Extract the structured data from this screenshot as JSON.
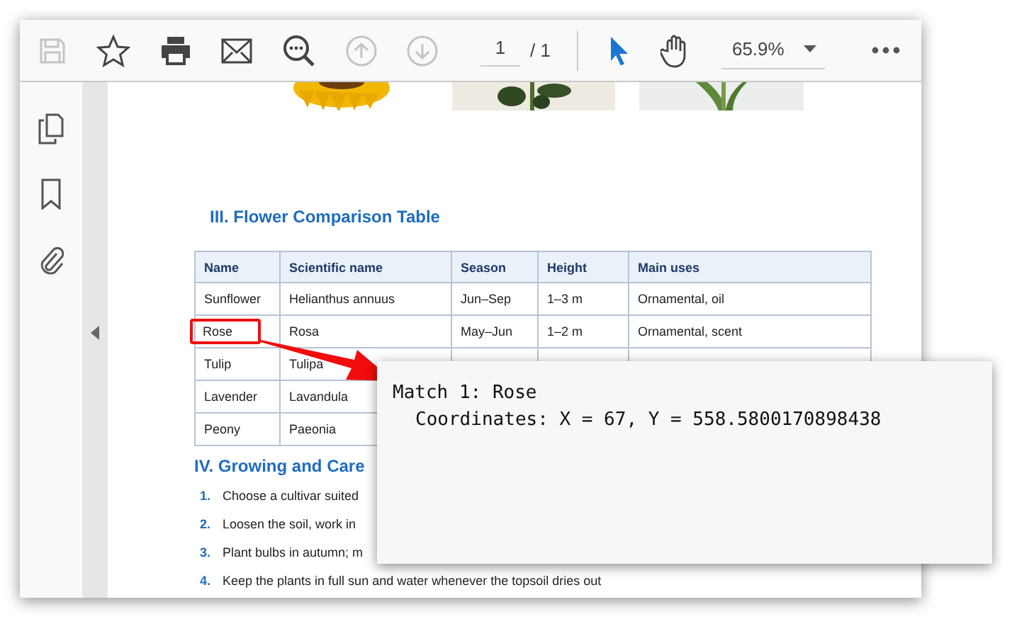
{
  "toolbar": {
    "tools": [
      {
        "kind": "save",
        "disabled": true
      },
      {
        "kind": "star",
        "disabled": false
      },
      {
        "kind": "print",
        "disabled": false
      },
      {
        "kind": "mail",
        "disabled": false
      },
      {
        "kind": "find",
        "disabled": false
      },
      {
        "kind": "up",
        "disabled": true
      },
      {
        "kind": "down",
        "disabled": true
      }
    ],
    "page_field": {
      "value": "1"
    },
    "page_total": "/ 1",
    "modes": [
      {
        "kind": "pointer",
        "selected": true
      },
      {
        "kind": "hand",
        "selected": false
      }
    ],
    "zoom": {
      "value": "65.9%"
    }
  },
  "sidebar": {
    "items": [
      {
        "kind": "pages"
      },
      {
        "kind": "bookmark"
      },
      {
        "kind": "attach"
      }
    ]
  },
  "document": {
    "section_heading": "III. Flower Comparison Table",
    "table": {
      "columns": [
        "Name",
        "Scientific name",
        "Season",
        "Height",
        "Main uses"
      ],
      "rows": [
        {
          "cells": [
            "Sunflower",
            "Helianthus annuus",
            "Jun–Sep",
            "1–3 m",
            "Ornamental, oil"
          ],
          "highlighted": false
        },
        {
          "cells": [
            "Rose",
            "Rosa",
            "May–Jun",
            "1–2 m",
            "Ornamental, scent"
          ],
          "highlighted": true
        },
        {
          "cells": [
            "Tulip",
            "Tulipa"
          ],
          "highlighted": false
        },
        {
          "cells": [
            "Lavender",
            "Lavandula"
          ],
          "highlighted": false
        },
        {
          "cells": [
            "Peony",
            "Paeonia"
          ],
          "highlighted": false
        }
      ]
    },
    "next_heading": "IV. Growing and Care",
    "steps": [
      {
        "number": "1.",
        "text": "Choose a cultivar suited"
      },
      {
        "number": "2.",
        "text": "Loosen the soil, work in"
      },
      {
        "number": "3.",
        "text": "Plant bulbs in autumn; m"
      },
      {
        "number": "4.",
        "text": "Keep the plants in full sun and water whenever the topsoil dries out"
      }
    ]
  },
  "popup": {
    "title": "Match 1: Rose",
    "detail": "Coordinates: X = 67, Y = 558.5800170898438"
  }
}
